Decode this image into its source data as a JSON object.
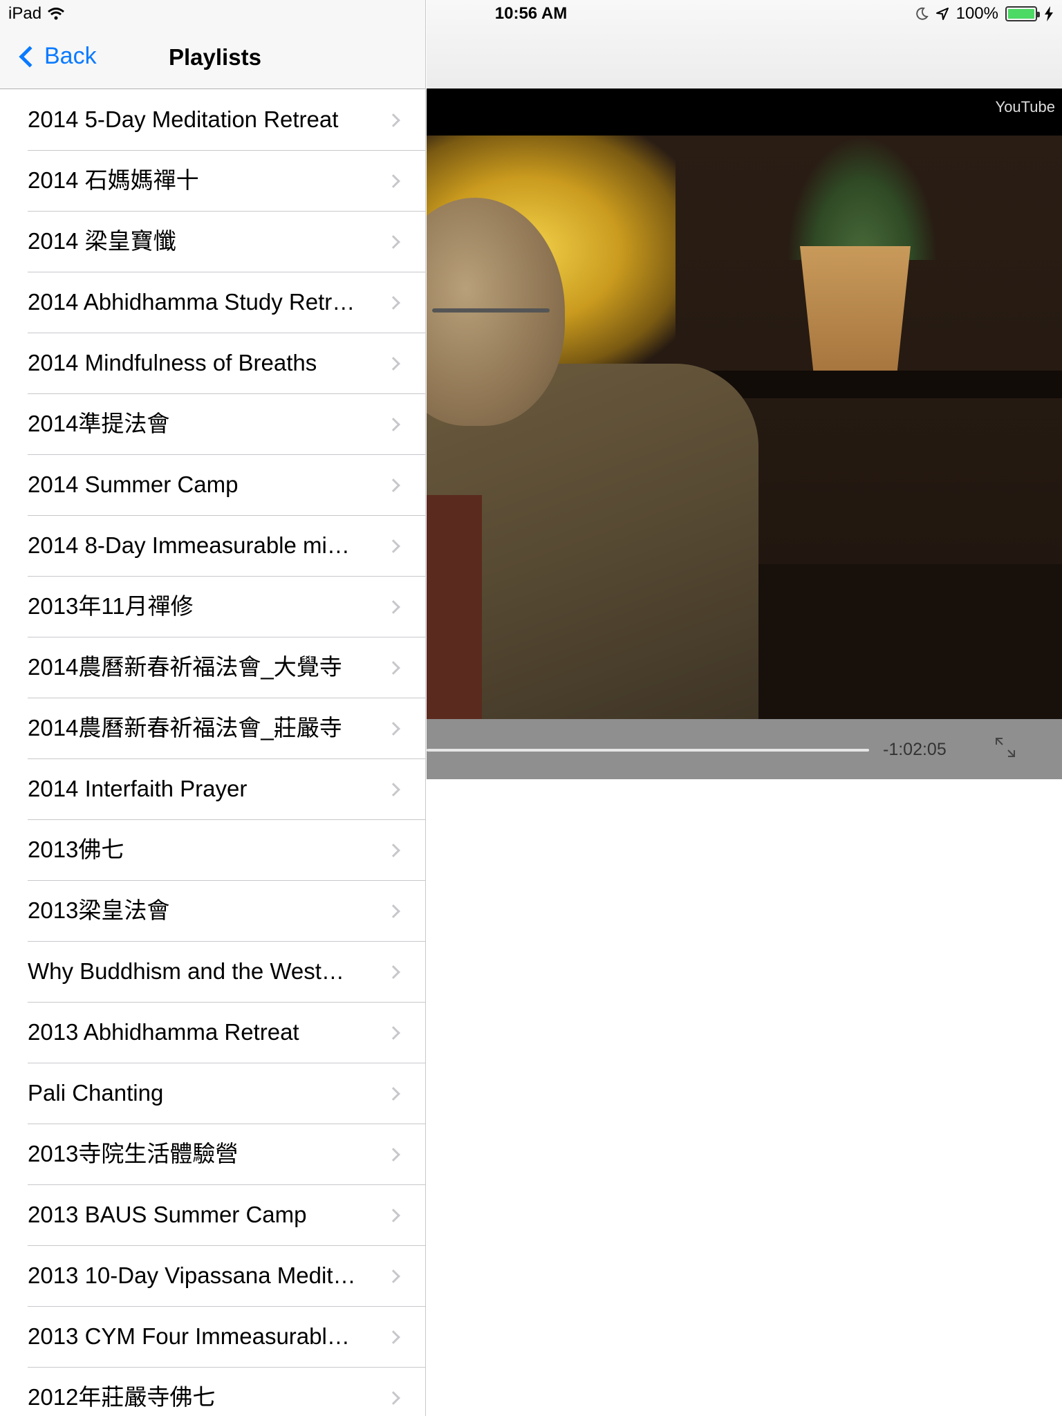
{
  "status_bar": {
    "device": "iPad",
    "time": "10:56 AM",
    "battery": "100%",
    "battery_level": 1.0
  },
  "master": {
    "back_label": "Back",
    "title": "Playlists",
    "items": [
      {
        "label": "2014 5-Day Meditation Retreat"
      },
      {
        "label": "2014 石媽媽禪十"
      },
      {
        "label": "2014 梁皇寶懺"
      },
      {
        "label": "2014 Abhidhamma Study Retr…"
      },
      {
        "label": "2014 Mindfulness of Breaths"
      },
      {
        "label": "2014準提法會"
      },
      {
        "label": "2014 Summer Camp"
      },
      {
        "label": "2014 8-Day Immeasurable mi…"
      },
      {
        "label": "2013年11月禪修"
      },
      {
        "label": "2014農曆新春祈福法會_大覺寺"
      },
      {
        "label": "2014農曆新春祈福法會_莊嚴寺"
      },
      {
        "label": "2014 Interfaith Prayer"
      },
      {
        "label": "2013佛七"
      },
      {
        "label": "2013梁皇法會"
      },
      {
        "label": "Why Buddhism and the West…"
      },
      {
        "label": "2013 Abhidhamma Retreat"
      },
      {
        "label": "Pali Chanting"
      },
      {
        "label": "2013寺院生活體驗營"
      },
      {
        "label": "2013 BAUS Summer Camp"
      },
      {
        "label": "2013 10-Day Vipassana Medit…"
      },
      {
        "label": "2013 CYM Four Immeasurabl…"
      },
      {
        "label": "2012年莊嚴寺佛七"
      }
    ]
  },
  "player": {
    "brand": "YouTube",
    "time_remaining": "-1:02:05"
  },
  "icons": {
    "wifi": "wifi-icon",
    "moon": "moon-icon",
    "location": "location-arrow-icon",
    "battery": "battery-icon",
    "charging": "charging-bolt-icon",
    "back": "chevron-left-icon",
    "row": "chevron-right-icon",
    "expand": "expand-icon"
  },
  "colors": {
    "tint": "#0a7aff",
    "battery_green": "#4cd964",
    "separator": "#c8c7cc"
  }
}
